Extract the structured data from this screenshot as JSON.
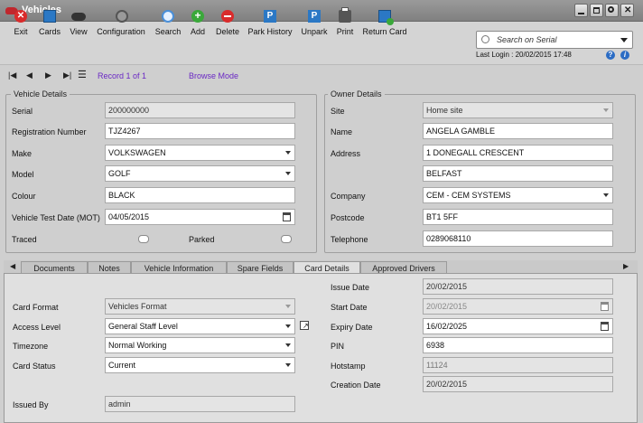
{
  "window": {
    "title": "Vehicles"
  },
  "toolbar": {
    "items": [
      {
        "label": "Exit",
        "icon": "exit-icon"
      },
      {
        "label": "Cards",
        "icon": "cards-icon"
      },
      {
        "label": "View",
        "icon": "view-icon"
      },
      {
        "label": "Configuration",
        "icon": "configuration-icon"
      },
      {
        "label": "Search",
        "icon": "search-icon"
      },
      {
        "label": "Add",
        "icon": "add-icon"
      },
      {
        "label": "Delete",
        "icon": "delete-icon"
      },
      {
        "label": "Park History",
        "icon": "park-history-icon"
      },
      {
        "label": "Unpark",
        "icon": "unpark-icon"
      },
      {
        "label": "Print",
        "icon": "print-icon"
      },
      {
        "label": "Return Card",
        "icon": "return-card-icon"
      }
    ]
  },
  "search": {
    "placeholder": "Search on Serial"
  },
  "last_login": "Last Login : 20/02/2015 17:48",
  "nav": {
    "record": "Record 1 of 1",
    "mode": "Browse Mode"
  },
  "vehicle": {
    "legend": "Vehicle Details",
    "serial_label": "Serial",
    "serial": "200000000",
    "reg_label": "Registration Number",
    "reg": "TJZ4267",
    "make_label": "Make",
    "make": "VOLKSWAGEN",
    "model_label": "Model",
    "model": "GOLF",
    "colour_label": "Colour",
    "colour": "BLACK",
    "mot_label": "Vehicle Test Date (MOT)",
    "mot": "04/05/2015",
    "traced_label": "Traced",
    "parked_label": "Parked"
  },
  "owner": {
    "legend": "Owner Details",
    "site_label": "Site",
    "site": "Home site",
    "name_label": "Name",
    "name": "ANGELA GAMBLE",
    "address_label": "Address",
    "address1": "1 DONEGALL CRESCENT",
    "address2": "BELFAST",
    "company_label": "Company",
    "company": "CEM - CEM SYSTEMS",
    "postcode_label": "Postcode",
    "postcode": "BT1 5FF",
    "telephone_label": "Telephone",
    "telephone": "0289068110"
  },
  "tabs": [
    "Documents",
    "Notes",
    "Vehicle Information",
    "Spare Fields",
    "Card Details",
    "Approved Drivers"
  ],
  "card": {
    "format_label": "Card Format",
    "format": "Vehicles Format",
    "access_label": "Access Level",
    "access": "General Staff Level",
    "timezone_label": "Timezone",
    "timezone": "Normal Working",
    "status_label": "Card Status",
    "status": "Current",
    "issuedby_label": "Issued By",
    "issuedby": "admin",
    "issue_label": "Issue Date",
    "issue": "20/02/2015",
    "start_label": "Start Date",
    "start": "20/02/2015",
    "expiry_label": "Expiry Date",
    "expiry": "16/02/2025",
    "pin_label": "PIN",
    "pin": "6938",
    "hotstamp_label": "Hotstamp",
    "hotstamp": "11124",
    "creation_label": "Creation Date",
    "creation": "20/02/2015"
  }
}
